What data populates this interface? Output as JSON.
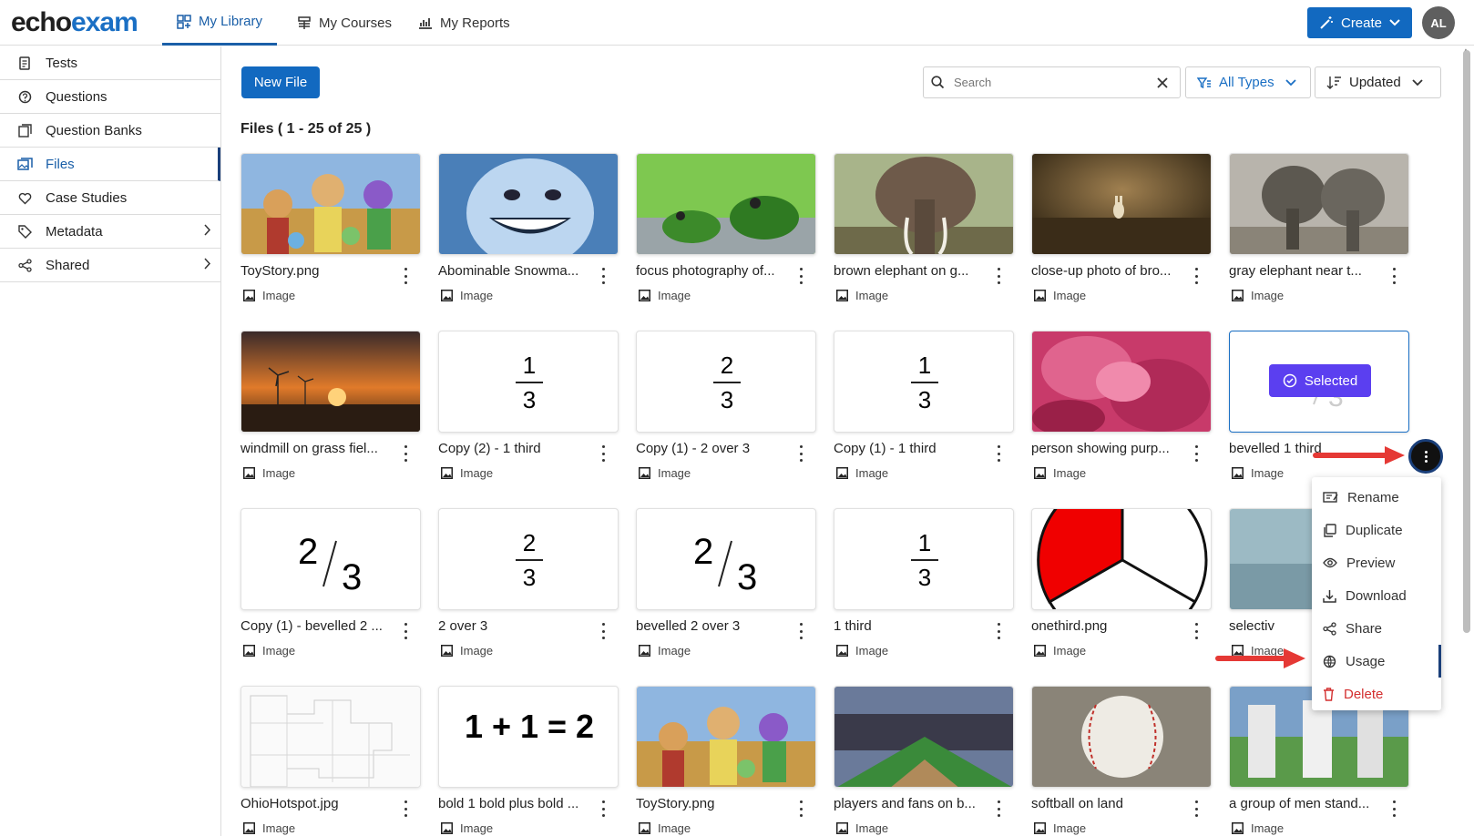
{
  "header": {
    "logo_part1": "echo",
    "logo_part2": "exam",
    "tabs": [
      {
        "label": "My Library",
        "icon": "library-icon"
      },
      {
        "label": "My Courses",
        "icon": "courses-icon"
      },
      {
        "label": "My Reports",
        "icon": "reports-icon"
      }
    ],
    "create_label": "Create",
    "avatar_initials": "AL"
  },
  "sidebar": {
    "items": [
      {
        "label": "Tests",
        "icon": "test-icon"
      },
      {
        "label": "Questions",
        "icon": "question-icon"
      },
      {
        "label": "Question Banks",
        "icon": "bank-icon"
      },
      {
        "label": "Files",
        "icon": "files-icon",
        "active": true
      },
      {
        "label": "Case Studies",
        "icon": "case-study-icon"
      },
      {
        "label": "Metadata",
        "icon": "tag-icon",
        "has_submenu": true
      },
      {
        "label": "Shared",
        "icon": "share-icon",
        "has_submenu": true
      }
    ]
  },
  "toolbar": {
    "new_file_label": "New File",
    "search_placeholder": "Search",
    "type_filter": "All Types",
    "sort_label": "Updated"
  },
  "files_heading": "Files ( 1 - 25 of 25 )",
  "files": [
    {
      "name": "ToyStory.png",
      "type": "Image"
    },
    {
      "name": "Abominable Snowma...",
      "type": "Image"
    },
    {
      "name": "focus photography of...",
      "type": "Image"
    },
    {
      "name": "brown elephant on g...",
      "type": "Image"
    },
    {
      "name": "close-up photo of bro...",
      "type": "Image"
    },
    {
      "name": "gray elephant near t...",
      "type": "Image"
    },
    {
      "name": "windmill on grass fiel...",
      "type": "Image"
    },
    {
      "name": "Copy (2) - 1 third",
      "type": "Image"
    },
    {
      "name": "Copy (1) - 2 over 3",
      "type": "Image"
    },
    {
      "name": "Copy (1) - 1 third",
      "type": "Image"
    },
    {
      "name": "person showing purp...",
      "type": "Image"
    },
    {
      "name": "bevelled 1 third",
      "type": "Image"
    },
    {
      "name": "Copy (1) - bevelled 2 ...",
      "type": "Image"
    },
    {
      "name": "2 over 3",
      "type": "Image"
    },
    {
      "name": "bevelled 2 over 3",
      "type": "Image"
    },
    {
      "name": "1 third",
      "type": "Image"
    },
    {
      "name": "onethird.png",
      "type": "Image"
    },
    {
      "name": "selectiv",
      "type": "Image"
    },
    {
      "name": "OhioHotspot.jpg",
      "type": "Image"
    },
    {
      "name": "bold 1 bold plus bold ...",
      "type": "Image"
    },
    {
      "name": "ToyStory.png",
      "type": "Image"
    },
    {
      "name": "players and fans on b...",
      "type": "Image"
    },
    {
      "name": "softball on land",
      "type": "Image"
    },
    {
      "name": "a group of men stand...",
      "type": "Image"
    }
  ],
  "thumb_text": {
    "frac_1": "1",
    "frac_2": "2",
    "frac_3": "3",
    "equation": "1 + 1 = 2"
  },
  "selected_badge": "Selected",
  "context_menu": [
    {
      "label": "Rename",
      "icon": "rename-icon"
    },
    {
      "label": "Duplicate",
      "icon": "duplicate-icon"
    },
    {
      "label": "Preview",
      "icon": "eye-icon"
    },
    {
      "label": "Download",
      "icon": "download-icon"
    },
    {
      "label": "Share",
      "icon": "share-icon"
    },
    {
      "label": "Usage",
      "icon": "usage-icon",
      "active": true
    },
    {
      "label": "Delete",
      "icon": "trash-icon",
      "danger": true
    }
  ],
  "colors": {
    "brand_blue": "#1269c0",
    "selected_purple": "#5b3ff0",
    "annotation_red": "#e53935"
  }
}
